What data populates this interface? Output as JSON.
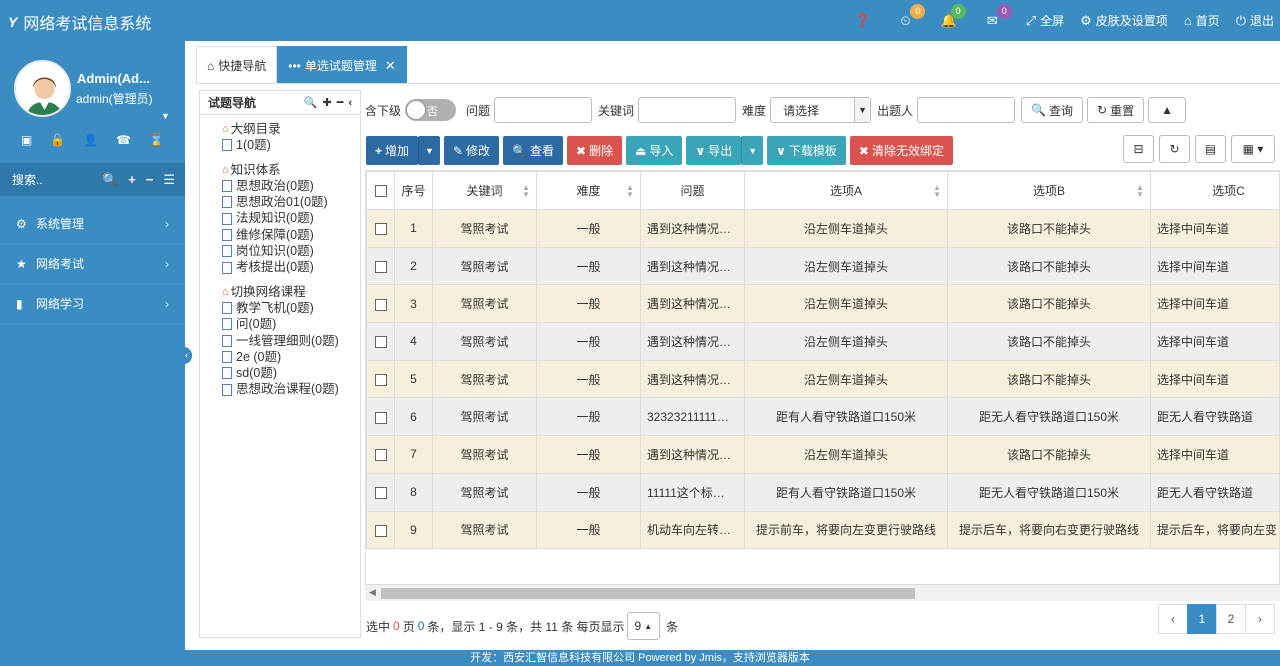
{
  "app": {
    "logo": "Y",
    "title": "网络考试信息系统"
  },
  "topnav": {
    "help_icon": "question-circle",
    "clock_badge": "0",
    "bell_badge": "0",
    "mail_badge": "0",
    "fullscreen": "全屏",
    "skin": "皮肤及设置项",
    "home": "首页",
    "logout": "退出",
    "colors": {
      "clock": "#f0ad4e",
      "bell": "#5cb85c",
      "mail": "#9b59b6"
    }
  },
  "user": {
    "name": "Admin(Ad...",
    "role": "admin(管理员)"
  },
  "sidebar": {
    "search_placeholder": "搜索..",
    "items": [
      {
        "label": "系统管理",
        "icon": "gears-icon"
      },
      {
        "label": "网络考试",
        "icon": "star-icon"
      },
      {
        "label": "网络学习",
        "icon": "bar-chart-icon"
      }
    ]
  },
  "tabs": {
    "quick_nav": "快捷导航",
    "current": "单选试题管理"
  },
  "tree": {
    "title": "试题导航",
    "groups": [
      {
        "label": "大纲目录",
        "children": [
          "1(0题)"
        ]
      },
      {
        "label": "知识体系",
        "children": [
          "思想政治(0题)",
          "思想政治01(0题)",
          "法规知识(0题)",
          "维修保障(0题)",
          "岗位知识(0题)",
          "考核提出(0题)"
        ]
      },
      {
        "label": "切换网络课程",
        "children": [
          "教学飞机(0题)",
          "问(0题)",
          "一线管理细则(0题)",
          "2e (0题)",
          "sd(0题)",
          "思想政治课程(0题)"
        ]
      }
    ]
  },
  "query": {
    "include_sub": "含下级",
    "toggle_value": "否",
    "question": "问题",
    "keyword": "关键词",
    "difficulty": "难度",
    "difficulty_select": "请选择",
    "author": "出题人",
    "search": "查询",
    "reset": "重置"
  },
  "toolbar": {
    "add": "增加",
    "edit": "修改",
    "view": "查看",
    "delete": "删除",
    "import": "导入",
    "export": "导出",
    "download_template": "下载模板",
    "clear_binding": "清除无效绑定"
  },
  "table": {
    "headers": [
      "序号",
      "关键词",
      "难度",
      "问题",
      "选项A",
      "选项B",
      "选项C"
    ],
    "rows": [
      [
        "1",
        "驾照考试",
        "一般",
        "遇到这种情况…",
        "沿左侧车道掉头",
        "该路口不能掉头",
        "选择中间车道"
      ],
      [
        "2",
        "驾照考试",
        "一般",
        "遇到这种情况…",
        "沿左侧车道掉头",
        "该路口不能掉头",
        "选择中间车道"
      ],
      [
        "3",
        "驾照考试",
        "一般",
        "遇到这种情况…",
        "沿左侧车道掉头",
        "该路口不能掉头",
        "选择中间车道"
      ],
      [
        "4",
        "驾照考试",
        "一般",
        "遇到这种情况…",
        "沿左侧车道掉头",
        "该路口不能掉头",
        "选择中间车道"
      ],
      [
        "5",
        "驾照考试",
        "一般",
        "遇到这种情况…",
        "沿左侧车道掉头",
        "该路口不能掉头",
        "选择中间车道"
      ],
      [
        "6",
        "驾照考试",
        "一般",
        "32323211111…",
        "距有人看守铁路道口150米",
        "距无人看守铁路道口150米",
        "距无人看守铁路道"
      ],
      [
        "7",
        "驾照考试",
        "一般",
        "遇到这种情况…",
        "沿左侧车道掉头",
        "该路口不能掉头",
        "选择中间车道"
      ],
      [
        "8",
        "驾照考试",
        "一般",
        "11111这个标…",
        "距有人看守铁路道口150米",
        "距无人看守铁路道口150米",
        "距无人看守铁路道"
      ],
      [
        "9",
        "驾照考试",
        "一般",
        "机动车向左转…",
        "提示前车，将要向左变更行驶路线",
        "提示后车，将要向右变更行驶路线",
        "提示后车，将要向左变"
      ]
    ]
  },
  "pager": {
    "selected_label": "选中",
    "selected": "0",
    "page_unit": "页",
    "items": "0",
    "summary": "条，显示 1 - 9 条，共 11 条 每页显示",
    "page_size": "9",
    "unit": "条",
    "prev": "‹",
    "pages": [
      "1",
      "2"
    ],
    "next": "›"
  },
  "footer": {
    "text": "开发：西安汇智信息科技有限公司 Powered by Jmis，支持浏览器版本"
  }
}
